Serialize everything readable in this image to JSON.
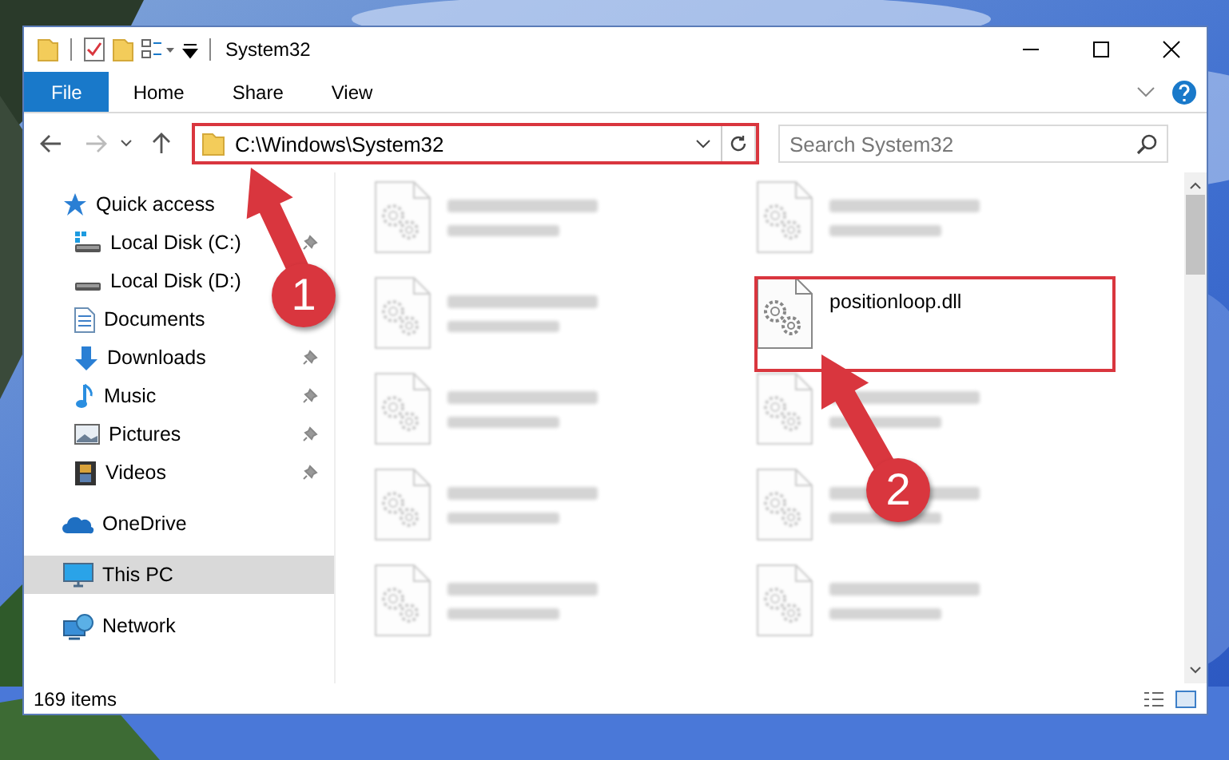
{
  "window": {
    "title": "System32"
  },
  "ribbon": {
    "tabs": [
      {
        "label": "File",
        "kind": "file",
        "selected": false
      },
      {
        "label": "Home",
        "kind": "tab",
        "selected": false
      },
      {
        "label": "Share",
        "kind": "tab",
        "selected": false
      },
      {
        "label": "View",
        "kind": "tab",
        "selected": false
      }
    ]
  },
  "address": {
    "path": "C:\\Windows\\System32"
  },
  "search": {
    "placeholder": "Search System32"
  },
  "nav": {
    "items": [
      {
        "label": "Quick access",
        "kind": "star",
        "selected": false,
        "children": [
          {
            "label": "Local Disk (C:)",
            "kind": "system-drive",
            "pinned": true,
            "selected": false
          },
          {
            "label": "Local Disk (D:)",
            "kind": "drive",
            "selected": false
          },
          {
            "label": "Documents",
            "kind": "document",
            "selected": false
          },
          {
            "label": "Downloads",
            "kind": "download",
            "pinned": true,
            "selected": false
          },
          {
            "label": "Music",
            "kind": "music",
            "pinned": true,
            "selected": false
          },
          {
            "label": "Pictures",
            "pinned": true,
            "selected": false
          },
          {
            "label": "Videos",
            "kind": "video",
            "pinned": true,
            "selected": false
          }
        ]
      },
      {
        "label": "OneDrive",
        "kind": "cloud",
        "selected": false
      },
      {
        "label": "This PC",
        "kind": "computer",
        "selected": true
      },
      {
        "label": "Network",
        "kind": "network",
        "selected": false
      }
    ]
  },
  "files": [
    {
      "kind": "blurred"
    },
    {
      "kind": "blurred"
    },
    {
      "kind": "blurred"
    },
    {
      "kind": "file",
      "name": "positionloop.dll"
    },
    {
      "kind": "blurred"
    },
    {
      "kind": "blurred"
    },
    {
      "kind": "blurred"
    },
    {
      "kind": "blurred"
    },
    {
      "kind": "blurred"
    },
    {
      "kind": "blurred"
    }
  ],
  "status_bar": {
    "count": "169 items"
  },
  "annotations": [
    {
      "label": "1"
    },
    {
      "label": "2"
    }
  ]
}
